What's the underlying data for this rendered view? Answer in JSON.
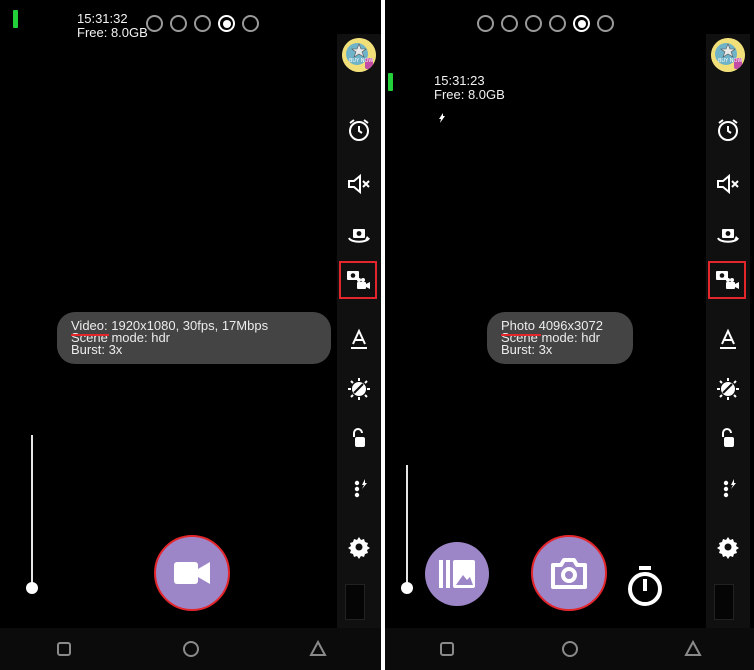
{
  "left_panel": {
    "status": {
      "time": "15:31:32",
      "free": "Free: 8.0GB"
    },
    "page_dots": {
      "count": 5,
      "active_index": 3
    },
    "info": {
      "line1": "Video: 1920x1080, 30fps, 17Mbps",
      "line2": "Scene mode: hdr",
      "line3": "Burst: 3x"
    },
    "shutter_mode": "video"
  },
  "right_panel": {
    "status": {
      "time": "15:31:23",
      "free": "Free: 8.0GB"
    },
    "page_dots": {
      "count": 6,
      "active_index": 4
    },
    "info": {
      "line1": "Photo 4096x3072",
      "line2": "Scene mode: hdr",
      "line3": "Burst: 3x"
    },
    "shutter_mode": "photo"
  },
  "toolbar_icons": [
    "avatar-buy-now-icon",
    "timer-icon",
    "mute-icon",
    "switch-camera-icon",
    "photo-video-mode-icon",
    "text-stamp-icon",
    "exposure-icon",
    "lock-icon",
    "more-flash-icon",
    "settings-icon"
  ],
  "avatar_badge": "BUY NOW",
  "nav_icons": [
    "recent-apps-icon",
    "home-icon",
    "back-icon"
  ],
  "colors": {
    "accent_red": "#e3262b",
    "shutter_purple": "#9d86c8",
    "battery_green": "#22d13a"
  }
}
